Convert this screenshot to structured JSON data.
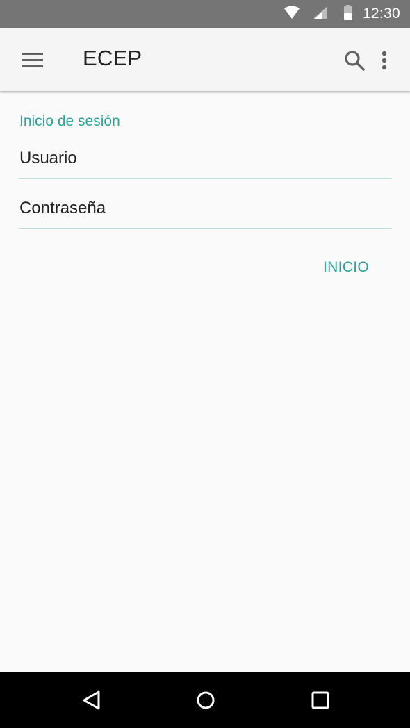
{
  "status_bar": {
    "time": "12:30",
    "icons": [
      "wifi-icon",
      "signal-icon",
      "battery-icon"
    ],
    "background": "#757575"
  },
  "app_bar": {
    "title": "ECEP",
    "actions": [
      "menu-icon",
      "search-icon",
      "more-vert-icon"
    ]
  },
  "login": {
    "section_title": "Inicio de sesión",
    "user_field": {
      "placeholder": "Usuario",
      "value": ""
    },
    "password_field": {
      "placeholder": "Contraseña",
      "value": ""
    },
    "submit_label": "INICIO"
  },
  "nav_bar": {
    "buttons": [
      "back-icon",
      "home-icon",
      "recents-icon"
    ]
  },
  "colors": {
    "accent": "#26a69a",
    "app_bar": "#f5f5f5",
    "background": "#fafafa",
    "divider": "#b2dfdb"
  }
}
